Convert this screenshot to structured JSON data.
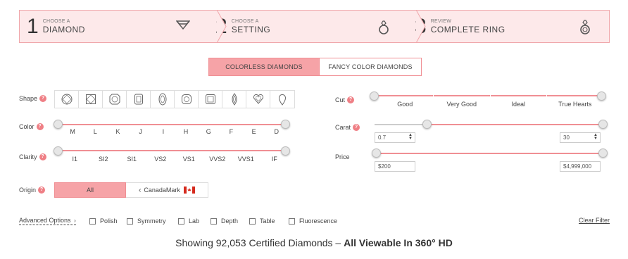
{
  "steps": [
    {
      "num": "1",
      "small": "CHOOSE A",
      "big": "DIAMOND",
      "icon": "diamond-icon"
    },
    {
      "num": "2",
      "small": "CHOOSE A",
      "big": "SETTING",
      "icon": "ring-setting-icon"
    },
    {
      "num": "3",
      "small": "REVIEW",
      "big": "COMPLETE RING",
      "icon": "complete-ring-icon"
    }
  ],
  "tabs": {
    "colorless": "COLORLESS DIAMONDS",
    "fancy": "FANCY COLOR DIAMONDS"
  },
  "filters": {
    "shape_label": "Shape",
    "color_label": "Color",
    "clarity_label": "Clarity",
    "origin_label": "Origin",
    "cut_label": "Cut",
    "carat_label": "Carat",
    "price_label": "Price",
    "help": "?"
  },
  "shapes": [
    "round-shape-icon",
    "princess-shape-icon",
    "asscher-shape-icon",
    "radiant-shape-icon",
    "oval-shape-icon",
    "cushion-shape-icon",
    "emerald-shape-icon",
    "marquise-shape-icon",
    "heart-shape-icon",
    "pear-shape-icon"
  ],
  "color_ticks": [
    "M",
    "L",
    "K",
    "J",
    "I",
    "H",
    "G",
    "F",
    "E",
    "D"
  ],
  "clarity_ticks": [
    "I1",
    "SI2",
    "SI1",
    "VS2",
    "VS1",
    "VVS2",
    "VVS1",
    "IF"
  ],
  "cut_ticks": [
    "Good",
    "Very Good",
    "Ideal",
    "True Hearts"
  ],
  "carat": {
    "min": "0.7",
    "max": "30",
    "range_selected": [
      0.7,
      30
    ]
  },
  "price": {
    "min": "$200",
    "max": "$4,999,000"
  },
  "origin": {
    "all": "All",
    "canadamark": "CanadaMark"
  },
  "advanced": {
    "label": "Advanced Options",
    "checks": [
      "Polish",
      "Symmetry",
      "Lab",
      "Depth",
      "Table",
      "Fluorescence"
    ],
    "clear": "Clear Filter"
  },
  "results": {
    "prefix": "Showing 92,053 Certified Diamonds –",
    "bold": "All Viewable In 360° HD"
  },
  "colors": {
    "accent": "#f08f94",
    "accent_fill": "#f6a3a7",
    "step_bg": "#fde9ea"
  }
}
